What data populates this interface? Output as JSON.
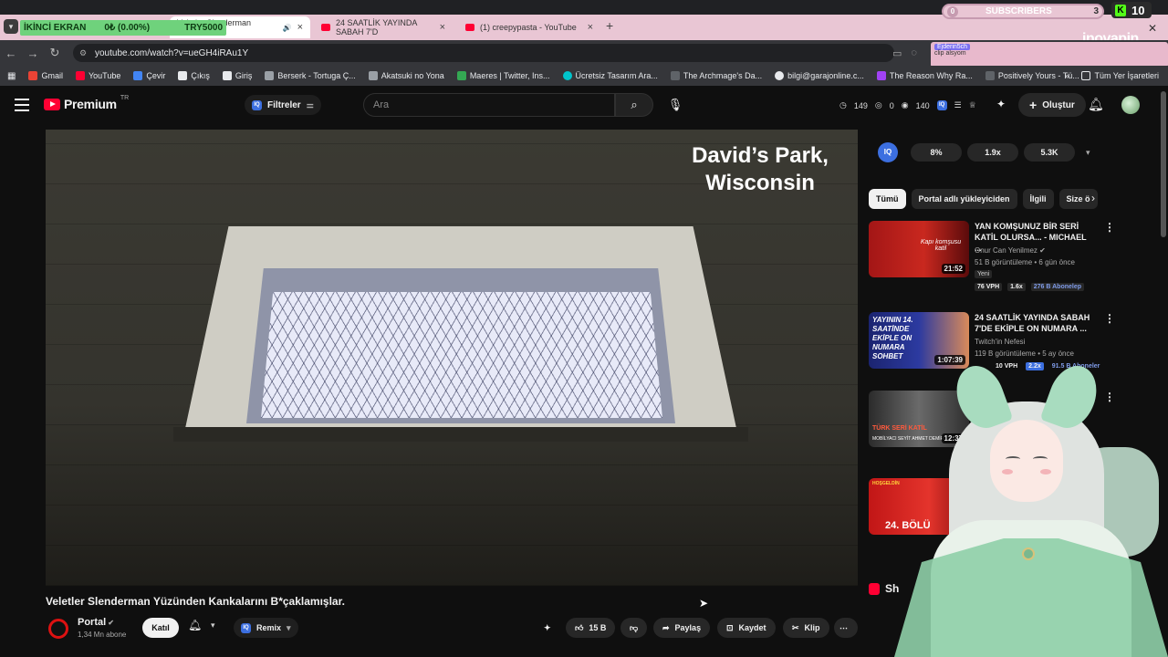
{
  "browser": {
    "tabs": [
      {
        "label": "Veletler Slenderman Yüzünd",
        "active": true
      },
      {
        "label": "24 SAATLİK YAYINDA SABAH 7'D",
        "active": false
      },
      {
        "label": "(1) creepypasta - YouTube",
        "active": false
      }
    ],
    "url": "youtube.com/watch?v=ueGH4iRAu1Y",
    "bookmarks": [
      {
        "label": "Gmail",
        "color": "#ea4335"
      },
      {
        "label": "YouTube",
        "color": "#ff0033"
      },
      {
        "label": "Çevir",
        "color": "#4285f4"
      },
      {
        "label": "Çıkış",
        "color": "#e8eaed"
      },
      {
        "label": "Giriş",
        "color": "#e8eaed"
      },
      {
        "label": "Berserk - Tortuga Ç...",
        "color": "#9aa0a6"
      },
      {
        "label": "Akatsuki no Yona",
        "color": "#9aa0a6"
      },
      {
        "label": "Maeres | Twitter, Ins...",
        "color": "#34a853"
      },
      {
        "label": "Ücretsiz Tasarım Ara...",
        "color": "#00c4cc"
      },
      {
        "label": "The Archmage's Da...",
        "color": "#5f6368"
      },
      {
        "label": "bilgi@garajonline.c...",
        "color": "#e8eaed"
      },
      {
        "label": "The Reason Why Ra...",
        "color": "#a142f4"
      },
      {
        "label": "Positively Yours - Tü...",
        "color": "#5f6368"
      }
    ],
    "all_bookmarks": "Tüm Yer İşaretleri"
  },
  "stream_overlay": {
    "screen_label": "İKİNCİ EKRAN",
    "goal_progress": "0₺ (0.00%)",
    "goal_amount": "TRY5000",
    "subscribers_label": "SUBSCRIBERS",
    "subscribers_left": "0",
    "subscribers_count": "3",
    "kick_count": "10",
    "brand": "inovapin",
    "chat_user": "Ejderin5ch",
    "chat_text": "clip alsyom"
  },
  "masthead": {
    "logo": "Premium",
    "logo_region": "TR",
    "filters": "Filtreler",
    "search_placeholder": "Ara",
    "stat_1": "149",
    "stat_2": "0",
    "stat_3": "140",
    "create": "Oluştur"
  },
  "video": {
    "overlay_line1": "David’s Park,",
    "overlay_line2": "Wisconsin",
    "title": "Veletler Slenderman Yüzünden Kankalarını B*çaklamışlar.",
    "channel": "Portal",
    "subscribers": "1,34 Mn abone",
    "join": "Katıl",
    "remix": "Remix",
    "likes": "15 B",
    "share": "Paylaş",
    "save": "Kaydet",
    "clip": "Klip"
  },
  "sidebar": {
    "iq_logo": "IQ",
    "iq_stats": [
      "8%",
      "1.9x",
      "5.3K"
    ],
    "chips": [
      "Tümü",
      "Portal adlı yükleyiciden",
      "İlgili",
      "Size ö"
    ],
    "related": [
      {
        "title": "YAN KOMŞUNUZ BİR SERİ KATİL OLURSA... - MICHAEL ...",
        "channel": "Onur Can Yenilmez",
        "meta": "51 B görüntüleme • 6 gün önce",
        "badge": "Yeni",
        "duration": "21:52",
        "vph": "76 VPH",
        "ratio": "1.6x",
        "subs": "276 B Abonelер",
        "thumb_text": "Kapı komşusu katil"
      },
      {
        "title": "24 SAATLİK YAYINDA SABAH 7'DE EKİPLE ON NUMARA ...",
        "channel": "Twitch'in Nefesi",
        "meta": "119 B görüntüleme • 5 ay önce",
        "duration": "1:07:39",
        "vph": "10 VPH",
        "ratio": "2.2x",
        "subs": "91.5 B Aboneler",
        "thumb_text": "YAYININ 14. SAATİNDE EKİPLE ON NUMARA SOHBET"
      },
      {
        "duration": "12:37",
        "thumb_text": "TÜRK SERİ KATİL",
        "thumb_sub": "MOBİLYACI SEYİT AHMET DEMİR"
      },
      {
        "thumb_text": "24. BÖLÜ",
        "thumb_top": "HOŞGELDİN"
      }
    ],
    "shorts": "Sh"
  }
}
